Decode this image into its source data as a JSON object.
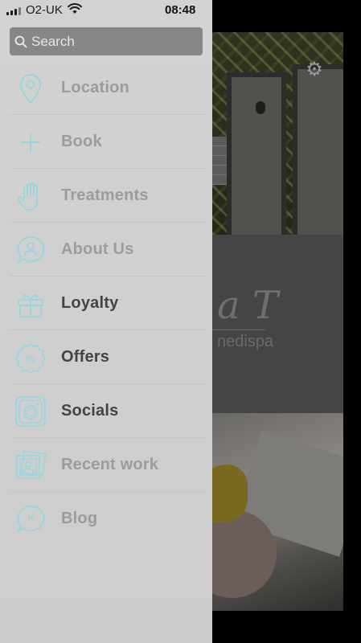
{
  "status_bar": {
    "carrier": "O2-UK",
    "time": "08:48"
  },
  "search": {
    "placeholder": "Search"
  },
  "menu": {
    "items": [
      {
        "label": "Location",
        "icon": "location-pin-icon",
        "style": "muted"
      },
      {
        "label": "Book",
        "icon": "plus-icon",
        "style": "muted"
      },
      {
        "label": "Treatments",
        "icon": "hand-icon",
        "style": "muted"
      },
      {
        "label": "About Us",
        "icon": "person-bubble-icon",
        "style": "muted"
      },
      {
        "label": "Loyalty",
        "icon": "gift-icon",
        "style": "strong"
      },
      {
        "label": "Offers",
        "icon": "percent-badge-icon",
        "style": "strong"
      },
      {
        "label": "Socials",
        "icon": "camera-icon",
        "style": "strong"
      },
      {
        "label": "Recent work",
        "icon": "photos-icon",
        "style": "muted"
      },
      {
        "label": "Blog",
        "icon": "quote-bubble-icon",
        "style": "muted"
      }
    ]
  },
  "background": {
    "logo_text": "a T",
    "logo_subtext": "nedispa"
  },
  "colors": {
    "drawer_bg": "#d0d0d0",
    "icon_accent": "#8fd6e0",
    "label_muted": "#9c9c9c",
    "label_strong": "#444444",
    "search_bg": "#878787"
  }
}
